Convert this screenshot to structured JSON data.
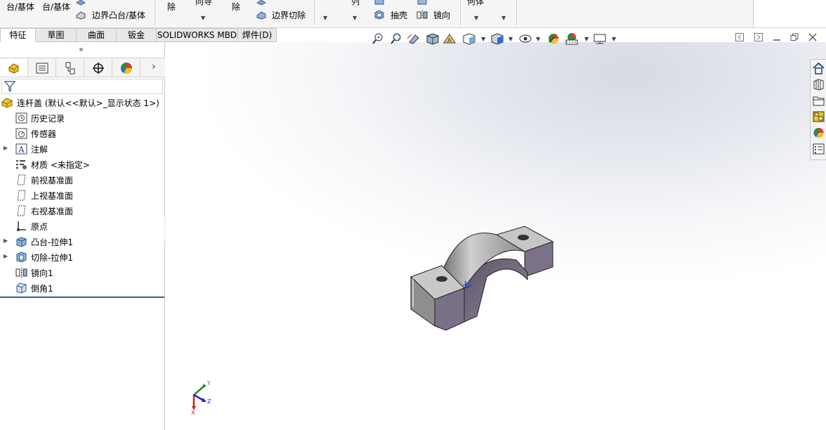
{
  "ribbon": {
    "items": [
      {
        "label": "台/基体"
      },
      {
        "label": "台/基体"
      },
      {
        "label": "边界凸台/基体"
      },
      {
        "label": "除"
      },
      {
        "label": "向导"
      },
      {
        "label": "除"
      },
      {
        "label": "边界切除"
      },
      {
        "label": "列"
      },
      {
        "label": "抽壳"
      },
      {
        "label": "镜向"
      },
      {
        "label": "何体"
      }
    ]
  },
  "command_tabs": [
    "特征",
    "草图",
    "曲面",
    "钣金",
    "SOLIDWORKS MBD",
    "焊件(D)"
  ],
  "feature_tree": {
    "root": "连杆盖 (默认<<默认>_显示状态 1>)",
    "items": [
      {
        "label": "历史记录",
        "icon": "history-icon"
      },
      {
        "label": "传感器",
        "icon": "sensor-icon"
      },
      {
        "label": "注解",
        "icon": "annotation-icon"
      },
      {
        "label": "材质 <未指定>",
        "icon": "material-icon"
      },
      {
        "label": "前视基准面",
        "icon": "plane-icon"
      },
      {
        "label": "上视基准面",
        "icon": "plane-icon"
      },
      {
        "label": "右视基准面",
        "icon": "plane-icon"
      },
      {
        "label": "原点",
        "icon": "origin-icon"
      },
      {
        "label": "凸台-拉伸1",
        "icon": "boss-extrude-icon"
      },
      {
        "label": "切除-拉伸1",
        "icon": "cut-extrude-icon"
      },
      {
        "label": "镜向1",
        "icon": "mirror-icon"
      },
      {
        "label": "倒角1",
        "icon": "chamfer-icon"
      }
    ]
  },
  "triad": {
    "x": "X",
    "y": "Y",
    "z": "Z"
  },
  "colors": {
    "accent": "#2b5fb0",
    "part_face": "#a8a8a8",
    "part_inner": "#7d7388"
  }
}
